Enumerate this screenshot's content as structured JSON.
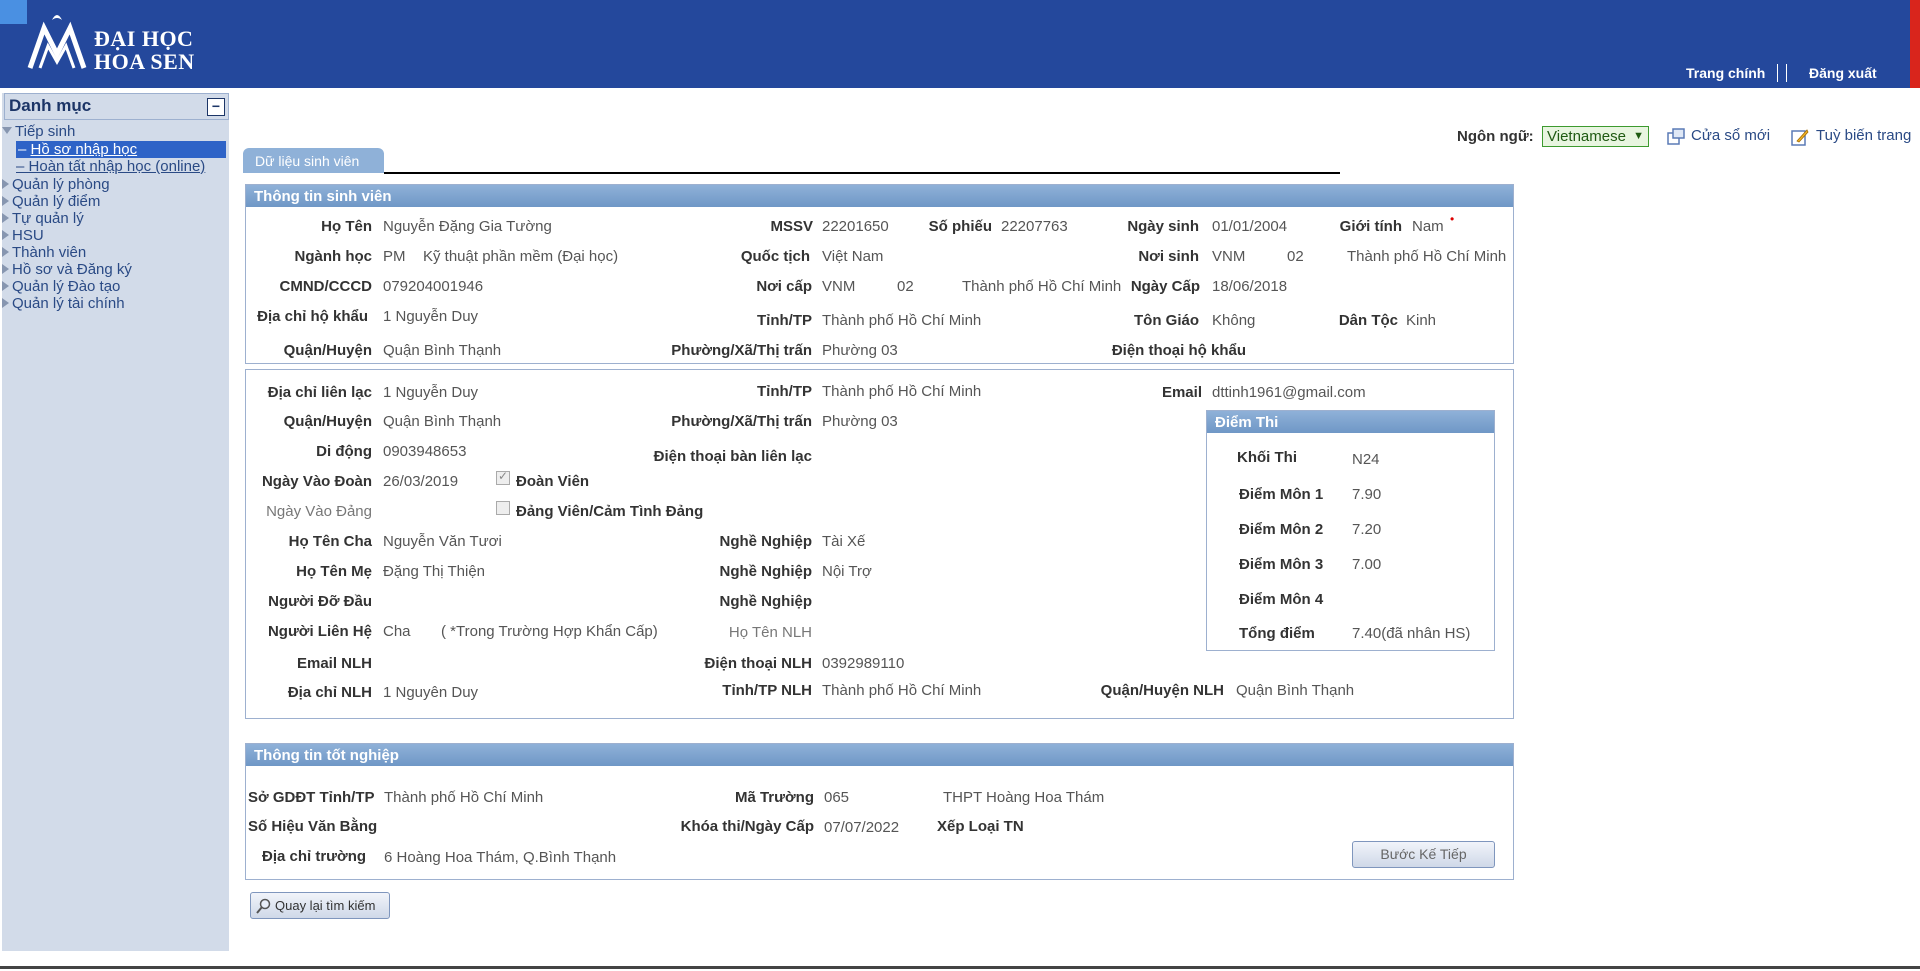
{
  "header": {
    "logo_line1": "ĐẠI HỌC",
    "logo_line2": "HOA SEN",
    "nav": [
      "Trang chính",
      "Đăng xuất"
    ]
  },
  "sidebar": {
    "title": "Danh mục",
    "collapse": "−",
    "items": [
      {
        "label": "Tiếp sinh",
        "expanded": true
      },
      {
        "label": "Hồ sơ nhập học",
        "selected": true
      },
      {
        "label": "Hoàn tất nhập học (online)"
      },
      {
        "label": "Quản lý phòng"
      },
      {
        "label": "Quản lý điểm"
      },
      {
        "label": "Tự quản lý"
      },
      {
        "label": "HSU"
      },
      {
        "label": "Thành viên"
      },
      {
        "label": "Hồ sơ và Đăng ký"
      },
      {
        "label": "Quản lý Đào tạo"
      },
      {
        "label": "Quản lý tài chính"
      }
    ]
  },
  "toolbar": {
    "lang_label": "Ngôn ngữ:",
    "lang_value": "Vietnamese",
    "new_window": "Cửa sổ mới",
    "customize": "Tuỳ biến trang"
  },
  "tab": "Dữ liệu sinh viên",
  "student": {
    "header": "Thông tin sinh viên",
    "ho_ten_lbl": "Họ Tên",
    "ho_ten": "Nguyễn Đặng Gia Tường",
    "mssv_lbl": "MSSV",
    "mssv": "22201650",
    "so_phieu_lbl": "Số phiếu",
    "so_phieu": "22207763",
    "ngay_sinh_lbl": "Ngày sinh",
    "ngay_sinh": "01/01/2004",
    "gioi_tinh_lbl": "Giới tính",
    "gioi_tinh": "Nam",
    "nganh_lbl": "Ngành học",
    "nganh_code": "PM",
    "nganh": "Kỹ thuật phần mềm (Đại học)",
    "quoc_tich_lbl": "Quốc tịch",
    "quoc_tich": "Việt Nam",
    "noi_sinh_lbl": "Nơi sinh",
    "noi_sinh_code": "VNM",
    "noi_sinh_num": "02",
    "noi_sinh": "Thành phố Hồ Chí Minh",
    "cmnd_lbl": "CMND/CCCD",
    "cmnd": "079204001946",
    "noi_cap_lbl": "Nơi cấp",
    "noi_cap_code": "VNM",
    "noi_cap_num": "02",
    "noi_cap": "Thành phố Hồ Chí Minh",
    "ngay_cap_lbl": "Ngày Cấp",
    "ngay_cap": "18/06/2018",
    "dia_chi_hk_lbl": "Địa chỉ hộ khẩu",
    "dia_chi_hk": "1 Nguyễn Duy",
    "tinh_lbl": "Tỉnh/TP",
    "tinh": "Thành phố Hồ Chí Minh",
    "ton_giao_lbl": "Tôn Giáo",
    "ton_giao": "Không",
    "dan_toc_lbl": "Dân Tộc",
    "dan_toc": "Kinh",
    "quan_lbl": "Quận/Huyện",
    "quan": "Quận Bình Thạnh",
    "phuong_lbl": "Phường/Xã/Thị trấn",
    "phuong": "Phường 03",
    "dt_hk_lbl": "Điện thoại hộ khẩu"
  },
  "contact": {
    "dia_chi_ll_lbl": "Địa chỉ liên lạc",
    "dia_chi_ll": "1 Nguyễn Duy",
    "tinh_lbl": "Tỉnh/TP",
    "tinh": "Thành phố Hồ Chí Minh",
    "email_lbl": "Email",
    "email": "dttinh1961@gmail.com",
    "quan_lbl": "Quận/Huyện",
    "quan": "Quận Bình Thạnh",
    "phuong_lbl": "Phường/Xã/Thị trấn",
    "phuong": "Phường 03",
    "di_dong_lbl": "Di động",
    "di_dong": "0903948653",
    "dt_ban_lbl": "Điện thoại bàn liên lạc",
    "ngay_doan_lbl": "Ngày Vào Đoàn",
    "ngay_doan": "26/03/2019",
    "doan_vien_lbl": "Đoàn Viên",
    "ngay_dang_lbl": "Ngày Vào Đảng",
    "dang_vien_lbl": "Đảng Viên/Cảm Tình Đảng",
    "cha_lbl": "Họ Tên Cha",
    "cha": "Nguyễn Văn Tươi",
    "nghe_cha_lbl": "Nghề Nghiệp",
    "nghe_cha": "Tài Xế",
    "me_lbl": "Họ Tên Mẹ",
    "me": "Đặng Thị Thiện",
    "nghe_me_lbl": "Nghề Nghiệp",
    "nghe_me": "Nội Trợ",
    "do_dau_lbl": "Người Đỡ Đầu",
    "nghe_dd_lbl": "Nghề Nghiệp",
    "lien_he_lbl": "Người Liên Hệ",
    "lien_he": "Cha",
    "lien_he_note": "( *Trong Trường Hợp Khẩn Cấp)",
    "ten_nlh_lbl": "Họ Tên NLH",
    "email_nlh_lbl": "Email NLH",
    "dt_nlh_lbl": "Điện thoại NLH",
    "dt_nlh": "0392989110",
    "dc_nlh_lbl": "Địa chỉ NLH",
    "dc_nlh": "1 Nguyên Duy",
    "tinh_nlh_lbl": "Tỉnh/TP NLH",
    "tinh_nlh": "Thành phố Hồ Chí Minh",
    "quan_nlh_lbl": "Quận/Huyện NLH",
    "quan_nlh": "Quận Bình Thạnh"
  },
  "exam": {
    "header": "Điểm Thi",
    "khoi_lbl": "Khối Thi",
    "khoi": "N24",
    "mon1_lbl": "Điểm Môn 1",
    "mon1": "7.90",
    "mon2_lbl": "Điểm Môn 2",
    "mon2": "7.20",
    "mon3_lbl": "Điểm Môn 3",
    "mon3": "7.00",
    "mon4_lbl": "Điểm Môn 4",
    "tong_lbl": "Tổng điểm",
    "tong": "7.40(đã nhân HS)"
  },
  "grad": {
    "header": "Thông tin tốt nghiệp",
    "so_gddt_lbl": "Sở GDĐT Tỉnh/TP",
    "so_gddt": "Thành phố Hồ Chí Minh",
    "ma_truong_lbl": "Mã Trường",
    "ma_truong": "065",
    "ten_truong": "THPT Hoàng Hoa Thám",
    "so_hieu_lbl": "Số Hiệu Văn Bằng",
    "khoa_thi_lbl": "Khóa thi/Ngày Cấp",
    "khoa_thi": "07/07/2022",
    "xep_loai_lbl": "Xếp Loại TN",
    "dia_chi_lbl": "Địa chỉ trường",
    "dia_chi": "6 Hoàng Hoa Thám, Q.Bình Thạnh",
    "next_button": "Bước Kế Tiếp"
  },
  "back_button": "Quay lại tìm kiếm"
}
